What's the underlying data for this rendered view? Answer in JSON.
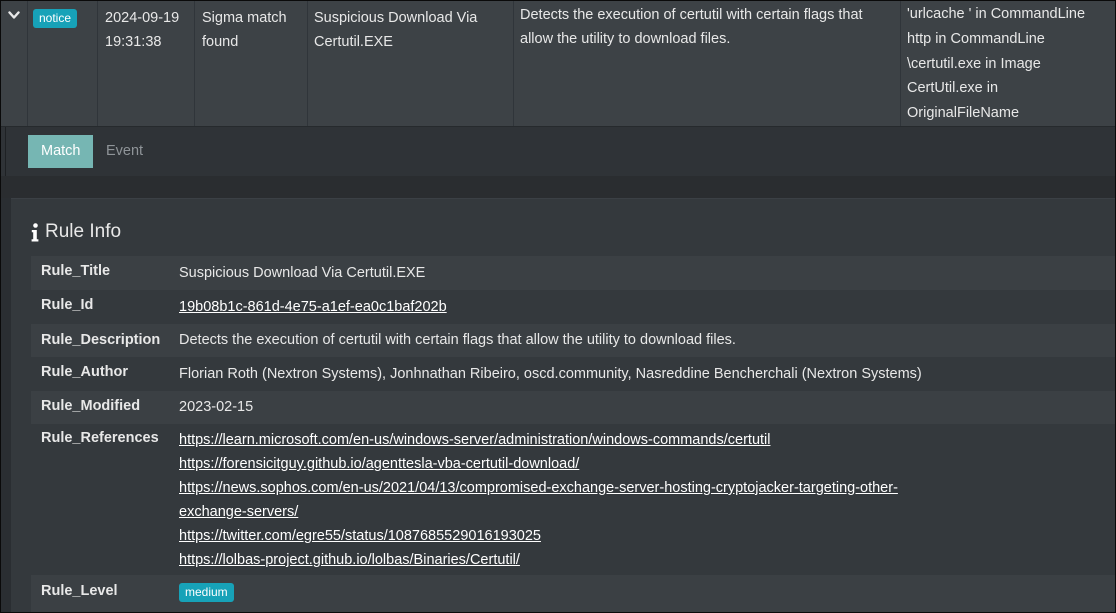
{
  "alert": {
    "level_badge": "notice",
    "timestamp_line1": "2024-09-19",
    "timestamp_line2": "19:31:38",
    "category_line1": "Sigma match",
    "category_line2": "found",
    "title_line1": "Suspicious Download Via",
    "title_line2": "Certutil.EXE",
    "description": "Detects the execution of certutil with certain flags that allow the utility to download files.",
    "matches": [
      "'urlcache ' in CommandLine",
      "http in CommandLine",
      "\\certutil.exe in Image",
      "CertUtil.exe in",
      "OriginalFileName"
    ]
  },
  "tabs": {
    "match": "Match",
    "event": "Event"
  },
  "rule_info": {
    "heading": "Rule Info",
    "rows": {
      "title": {
        "key": "Rule_Title",
        "value": "Suspicious Download Via Certutil.EXE"
      },
      "id": {
        "key": "Rule_Id",
        "value": "19b08b1c-861d-4e75-a1ef-ea0c1baf202b"
      },
      "description": {
        "key": "Rule_Description",
        "value": "Detects the execution of certutil with certain flags that allow the utility to download files."
      },
      "author": {
        "key": "Rule_Author",
        "value": "Florian Roth (Nextron Systems), Jonhnathan Ribeiro, oscd.community, Nasreddine Bencherchali (Nextron Systems)"
      },
      "modified": {
        "key": "Rule_Modified",
        "value": "2023-02-15"
      },
      "references": {
        "key": "Rule_References",
        "links": [
          "https://learn.microsoft.com/en-us/windows-server/administration/windows-commands/certutil",
          "https://forensicitguy.github.io/agenttesla-vba-certutil-download/",
          "https://news.sophos.com/en-us/2021/04/13/compromised-exchange-server-hosting-cryptojacker-targeting-other-",
          "exchange-servers/",
          "https://twitter.com/egre55/status/1087685529016193025",
          "https://lolbas-project.github.io/lolbas/Binaries/Certutil/"
        ]
      },
      "level": {
        "key": "Rule_Level",
        "value": "medium"
      }
    }
  },
  "icons": {
    "toggle": "chevron-down-icon",
    "info": "info-icon"
  },
  "colors": {
    "badge": "#17a2b8",
    "active_tab": "#76b6b3"
  }
}
